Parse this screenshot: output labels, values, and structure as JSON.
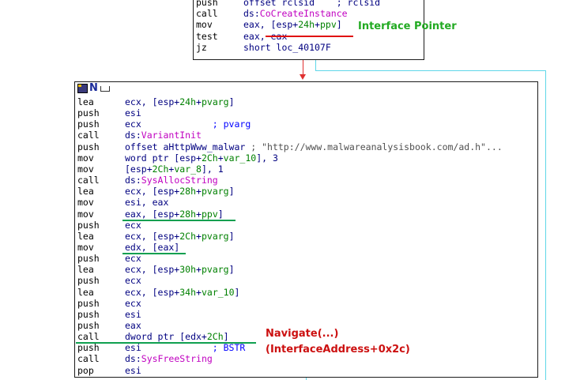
{
  "top_block": {
    "lines": [
      {
        "mnemonic": "push",
        "operand": [
          {
            "t": "offset rclsid",
            "c": "navy"
          },
          {
            "t": "    ; rclsid",
            "c": "navy"
          }
        ]
      },
      {
        "mnemonic": "call",
        "operand": [
          {
            "t": "ds:",
            "c": "navy"
          },
          {
            "t": "CoCreateInstance",
            "c": "magenta"
          }
        ]
      },
      {
        "mnemonic": "mov",
        "operand": [
          {
            "t": "eax, [esp+",
            "c": "navy"
          },
          {
            "t": "24h",
            "c": "green"
          },
          {
            "t": "+",
            "c": "navy"
          },
          {
            "t": "ppv",
            "c": "green"
          },
          {
            "t": "]",
            "c": "navy"
          }
        ]
      },
      {
        "mnemonic": "test",
        "operand": [
          {
            "t": "eax, eax",
            "c": "navy"
          }
        ]
      },
      {
        "mnemonic": "jz",
        "operand": [
          {
            "t": "short loc_40107F",
            "c": "navy"
          }
        ]
      }
    ]
  },
  "main_block": {
    "title_icon": "graph-node-icon",
    "lines": [
      {
        "mnemonic": "lea",
        "operand": [
          {
            "t": "ecx, [esp+",
            "c": "navy"
          },
          {
            "t": "24h",
            "c": "green"
          },
          {
            "t": "+",
            "c": "navy"
          },
          {
            "t": "pvarg",
            "c": "green"
          },
          {
            "t": "]",
            "c": "navy"
          }
        ]
      },
      {
        "mnemonic": "push",
        "operand": [
          {
            "t": "esi",
            "c": "navy"
          }
        ]
      },
      {
        "mnemonic": "push",
        "operand": [
          {
            "t": "ecx",
            "c": "navy"
          },
          {
            "t": "             ; pvarg",
            "c": "blue"
          }
        ]
      },
      {
        "mnemonic": "call",
        "operand": [
          {
            "t": "ds:",
            "c": "navy"
          },
          {
            "t": "VariantInit",
            "c": "magenta"
          }
        ]
      },
      {
        "mnemonic": "push",
        "operand": [
          {
            "t": "offset aHttpWww_malwar",
            "c": "navy"
          },
          {
            "t": " ; \"http://www.malwareanalysisbook.com/ad.h\"...",
            "c": "gray"
          }
        ]
      },
      {
        "mnemonic": "mov",
        "operand": [
          {
            "t": "word ptr [esp+",
            "c": "navy"
          },
          {
            "t": "2Ch",
            "c": "green"
          },
          {
            "t": "+",
            "c": "navy"
          },
          {
            "t": "var_10",
            "c": "green"
          },
          {
            "t": "], 3",
            "c": "navy"
          }
        ]
      },
      {
        "mnemonic": "mov",
        "operand": [
          {
            "t": "[esp+",
            "c": "navy"
          },
          {
            "t": "2Ch",
            "c": "green"
          },
          {
            "t": "+",
            "c": "navy"
          },
          {
            "t": "var_8",
            "c": "green"
          },
          {
            "t": "], 1",
            "c": "navy"
          }
        ]
      },
      {
        "mnemonic": "call",
        "operand": [
          {
            "t": "ds:",
            "c": "navy"
          },
          {
            "t": "SysAllocString",
            "c": "magenta"
          }
        ]
      },
      {
        "mnemonic": "lea",
        "operand": [
          {
            "t": "ecx, [esp+",
            "c": "navy"
          },
          {
            "t": "28h",
            "c": "green"
          },
          {
            "t": "+",
            "c": "navy"
          },
          {
            "t": "pvarg",
            "c": "green"
          },
          {
            "t": "]",
            "c": "navy"
          }
        ]
      },
      {
        "mnemonic": "mov",
        "operand": [
          {
            "t": "esi, eax",
            "c": "navy"
          }
        ]
      },
      {
        "mnemonic": "mov",
        "operand": [
          {
            "t": "eax, [esp+",
            "c": "navy"
          },
          {
            "t": "28h",
            "c": "green"
          },
          {
            "t": "+",
            "c": "navy"
          },
          {
            "t": "ppv",
            "c": "green"
          },
          {
            "t": "]",
            "c": "navy"
          }
        ]
      },
      {
        "mnemonic": "push",
        "operand": [
          {
            "t": "ecx",
            "c": "navy"
          }
        ]
      },
      {
        "mnemonic": "lea",
        "operand": [
          {
            "t": "ecx, [esp+",
            "c": "navy"
          },
          {
            "t": "2Ch",
            "c": "green"
          },
          {
            "t": "+",
            "c": "navy"
          },
          {
            "t": "pvarg",
            "c": "green"
          },
          {
            "t": "]",
            "c": "navy"
          }
        ]
      },
      {
        "mnemonic": "mov",
        "operand": [
          {
            "t": "edx, [eax]",
            "c": "navy"
          }
        ]
      },
      {
        "mnemonic": "push",
        "operand": [
          {
            "t": "ecx",
            "c": "navy"
          }
        ]
      },
      {
        "mnemonic": "lea",
        "operand": [
          {
            "t": "ecx, [esp+",
            "c": "navy"
          },
          {
            "t": "30h",
            "c": "green"
          },
          {
            "t": "+",
            "c": "navy"
          },
          {
            "t": "pvarg",
            "c": "green"
          },
          {
            "t": "]",
            "c": "navy"
          }
        ]
      },
      {
        "mnemonic": "push",
        "operand": [
          {
            "t": "ecx",
            "c": "navy"
          }
        ]
      },
      {
        "mnemonic": "lea",
        "operand": [
          {
            "t": "ecx, [esp+",
            "c": "navy"
          },
          {
            "t": "34h",
            "c": "green"
          },
          {
            "t": "+",
            "c": "navy"
          },
          {
            "t": "var_10",
            "c": "green"
          },
          {
            "t": "]",
            "c": "navy"
          }
        ]
      },
      {
        "mnemonic": "push",
        "operand": [
          {
            "t": "ecx",
            "c": "navy"
          }
        ]
      },
      {
        "mnemonic": "push",
        "operand": [
          {
            "t": "esi",
            "c": "navy"
          }
        ]
      },
      {
        "mnemonic": "push",
        "operand": [
          {
            "t": "eax",
            "c": "navy"
          }
        ]
      },
      {
        "mnemonic": "call",
        "operand": [
          {
            "t": "dword ptr [edx+",
            "c": "navy"
          },
          {
            "t": "2Ch",
            "c": "green"
          },
          {
            "t": "]",
            "c": "navy"
          }
        ]
      },
      {
        "mnemonic": "push",
        "operand": [
          {
            "t": "esi",
            "c": "navy"
          },
          {
            "t": "             ; BSTR",
            "c": "blue"
          }
        ]
      },
      {
        "mnemonic": "call",
        "operand": [
          {
            "t": "ds:",
            "c": "navy"
          },
          {
            "t": "SysFreeString",
            "c": "magenta"
          }
        ]
      },
      {
        "mnemonic": "pop",
        "operand": [
          {
            "t": "esi",
            "c": "navy"
          }
        ]
      }
    ]
  },
  "annotations": {
    "interface_pointer": "Interface Pointer",
    "navigate": "Navigate(...)",
    "interface_address": "(InterfaceAddress+0x2c)"
  },
  "colors": {
    "annotation_green": "#22aa22",
    "annotation_red": "#cc1010",
    "underline_red": "#e01010",
    "underline_green": "#10a050",
    "edge_cyan": "#5fd7e8",
    "edge_red": "#e03030"
  }
}
